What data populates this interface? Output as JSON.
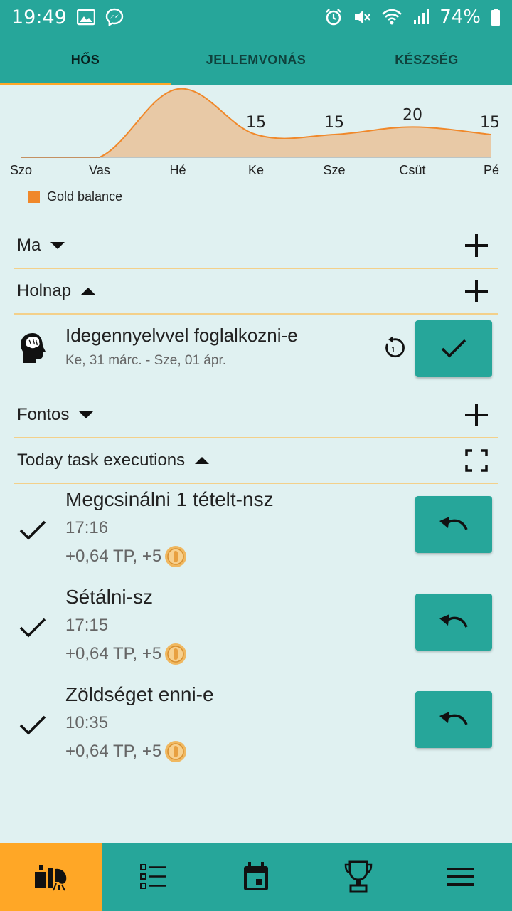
{
  "status": {
    "time": "19:49",
    "battery": "74%",
    "icons": [
      "image-icon",
      "messenger-icon",
      "alarm-icon",
      "mute-icon",
      "wifi-icon",
      "signal-icon",
      "battery-icon"
    ]
  },
  "tabs": [
    {
      "label": "HŐS",
      "active": true
    },
    {
      "label": "JELLEMVONÁS",
      "active": false
    },
    {
      "label": "KÉSZSÉG",
      "active": false
    }
  ],
  "chart_data": {
    "type": "area",
    "categories": [
      "Szo",
      "Vas",
      "Hé",
      "Ke",
      "Sze",
      "Csüt",
      "Pé"
    ],
    "series": [
      {
        "name": "Gold balance",
        "values": [
          0,
          0,
          45,
          15,
          15,
          20,
          15
        ],
        "color": "#f0882a"
      }
    ],
    "point_labels": [
      "",
      "",
      "",
      "15",
      "15",
      "20",
      "15"
    ],
    "xlabel": "",
    "ylabel": "",
    "grid": false,
    "legend": "bottom-left"
  },
  "sections": {
    "ma": {
      "title": "Ma"
    },
    "holnap": {
      "title": "Holnap"
    },
    "fontos": {
      "title": "Fontos"
    },
    "executions": {
      "title": "Today task executions"
    }
  },
  "tomorrow_task": {
    "title": "Idegennyelvvel foglalkozni-e",
    "dates": "Ke, 31 márc. - Sze, 01 ápr.",
    "repeat_count": "1",
    "icon": "brain-head-icon"
  },
  "executions": [
    {
      "title": "Megcsinálni 1 tételt-nsz",
      "time": "17:16",
      "reward": "+0,64 TP, +5"
    },
    {
      "title": "Sétálni-sz",
      "time": "17:15",
      "reward": "+0,64 TP, +5"
    },
    {
      "title": "Zöldséget enni-e",
      "time": "10:35",
      "reward": "+0,64 TP, +5"
    }
  ],
  "bottom_nav": [
    {
      "icon": "hero-icon",
      "active": true
    },
    {
      "icon": "list-icon",
      "active": false
    },
    {
      "icon": "calendar-icon",
      "active": false
    },
    {
      "icon": "trophy-icon",
      "active": false
    },
    {
      "icon": "menu-icon",
      "active": false
    }
  ],
  "colors": {
    "primary": "#26a69a",
    "accent": "#ffa726",
    "background": "#e0f1f1",
    "chart": "#f0882a"
  }
}
